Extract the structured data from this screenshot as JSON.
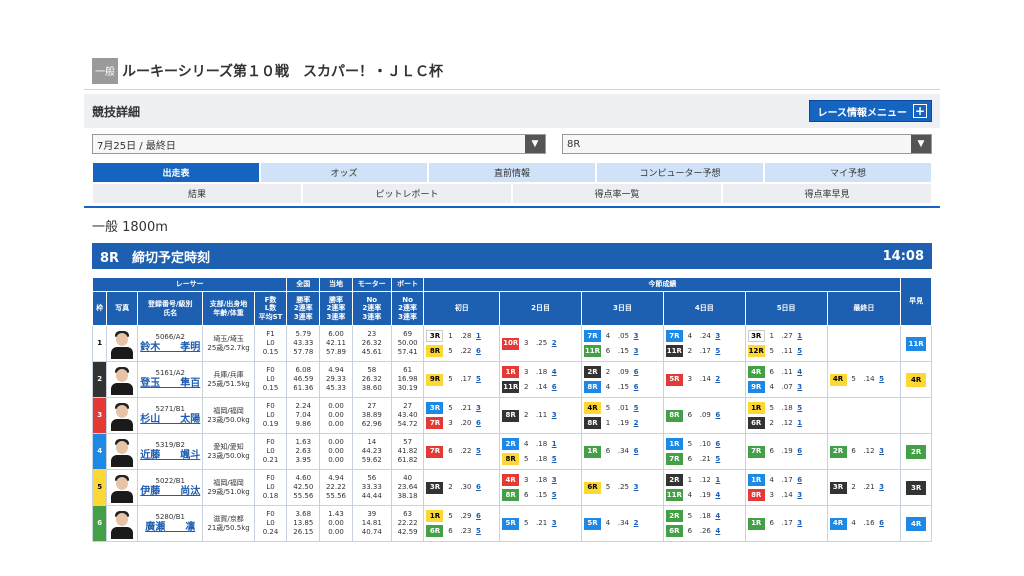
{
  "header": {
    "category_badge": "一般",
    "title": "ルーキーシリーズ第１０戦　スカパー！・ＪＬＣ杯"
  },
  "detail": {
    "heading": "競技詳細",
    "menu_button": "レース情報メニュー"
  },
  "selects": {
    "day": "7月25日 / 最終日",
    "race": "8R"
  },
  "tabs_row1": [
    "出走表",
    "オッズ",
    "直前情報",
    "コンピューター予想",
    "マイ予想"
  ],
  "tabs_row2": [
    "結果",
    "ピットレポート",
    "得点率一覧",
    "得点率早見"
  ],
  "race": {
    "name": "一般 1800m",
    "label": "8R　締切予定時刻",
    "time": "14:08"
  },
  "table_headers": {
    "racer": "レーサー",
    "zenkoku": "全国",
    "touchi": "当地",
    "motor": "モーター",
    "boat": "ボート",
    "konsetsu": "今節成績",
    "waku": "枠",
    "photo": "写真",
    "reg": "登録番号/級別\n氏名",
    "branch": "支部/出身地\n年齢/体重",
    "fls": "F数\nL数\n平均ST",
    "rate1": "勝率\n2連率\n3連率",
    "rate2": "勝率\n2連率\n3連率",
    "rate3": "No\n2連率\n3連率",
    "rate4": "No\n2連率\n3連率",
    "days": [
      "初日",
      "2日目",
      "3日目",
      "4日目",
      "5日目",
      "最終日"
    ],
    "hayami": "早見"
  },
  "racers": [
    {
      "frame": "1",
      "code": "5066/A2",
      "name": "鈴木　　孝明",
      "branch": "埼玉/埼玉",
      "age": "25歳/52.7kg",
      "f": "F1",
      "l": "L0",
      "st": "0.15",
      "z": [
        "5.79",
        "43.33",
        "57.78"
      ],
      "t": [
        "6.00",
        "42.11",
        "57.89"
      ],
      "m": [
        "23",
        "26.32",
        "45.61"
      ],
      "b": [
        "69",
        "50.00",
        "57.41"
      ],
      "d1": [
        [
          "3R",
          "1",
          ".28",
          "1",
          "c1"
        ],
        [
          "8R",
          "5",
          ".22",
          "6",
          "c5"
        ]
      ],
      "d2": [
        [
          "10R",
          "3",
          ".25",
          "2",
          "c3"
        ]
      ],
      "d3": [
        [
          "7R",
          "4",
          ".05",
          "3",
          "c4"
        ],
        [
          "11R",
          "6",
          ".15",
          "3",
          "c6"
        ]
      ],
      "d4": [
        [
          "7R",
          "4",
          ".24",
          "3",
          "c4"
        ],
        [
          "11R",
          "2",
          ".17",
          "5",
          "c2"
        ]
      ],
      "d5": [
        [
          "3R",
          "1",
          ".27",
          "1",
          "c1"
        ],
        [
          "12R",
          "5",
          ".11",
          "5",
          "c5"
        ]
      ],
      "d6": [],
      "hayami": "11R",
      "hc": "c4"
    },
    {
      "frame": "2",
      "code": "5161/A2",
      "name": "登玉　　隼百",
      "branch": "兵庫/兵庫",
      "age": "25歳/51.5kg",
      "f": "F0",
      "l": "L0",
      "st": "0.15",
      "z": [
        "6.08",
        "46.59",
        "61.36"
      ],
      "t": [
        "4.94",
        "29.33",
        "45.33"
      ],
      "m": [
        "58",
        "26.32",
        "38.60"
      ],
      "b": [
        "61",
        "16.98",
        "30.19"
      ],
      "d1": [
        [
          "9R",
          "5",
          ".17",
          "5",
          "c5"
        ]
      ],
      "d2": [
        [
          "1R",
          "3",
          ".18",
          "4",
          "c3"
        ],
        [
          "11R",
          "2",
          ".14",
          "6",
          "c2"
        ]
      ],
      "d3": [
        [
          "2R",
          "2",
          ".09",
          "6",
          "c2"
        ],
        [
          "8R",
          "4",
          ".15",
          "6",
          "c4"
        ]
      ],
      "d4": [
        [
          "5R",
          "3",
          ".14",
          "2",
          "c3"
        ]
      ],
      "d5": [
        [
          "4R",
          "6",
          ".11",
          "4",
          "c6"
        ],
        [
          "9R",
          "4",
          ".07",
          "3",
          "c4"
        ]
      ],
      "d6": [
        [
          "4R",
          "5",
          ".14",
          "5",
          "c5"
        ]
      ],
      "hayami": "4R",
      "hc": "c5"
    },
    {
      "frame": "3",
      "code": "5271/B1",
      "name": "杉山　　太陽",
      "branch": "福岡/福岡",
      "age": "23歳/50.0kg",
      "f": "F0",
      "l": "L0",
      "st": "0.19",
      "z": [
        "2.24",
        "7.04",
        "9.86"
      ],
      "t": [
        "0.00",
        "0.00",
        "0.00"
      ],
      "m": [
        "27",
        "38.89",
        "62.96"
      ],
      "b": [
        "27",
        "43.40",
        "54.72"
      ],
      "d1": [
        [
          "3R",
          "5",
          ".21",
          "3",
          "c4"
        ],
        [
          "7R",
          "3",
          ".20",
          "6",
          "c3"
        ]
      ],
      "d2": [
        [
          "8R",
          "2",
          ".11",
          "3",
          "c2"
        ]
      ],
      "d3": [
        [
          "4R",
          "5",
          ".01",
          "5",
          "c5"
        ],
        [
          "8R",
          "1",
          ".19",
          "2",
          "c2"
        ]
      ],
      "d4": [
        [
          "8R",
          "6",
          ".09",
          "6",
          "c6"
        ]
      ],
      "d5": [
        [
          "1R",
          "5",
          ".18",
          "5",
          "c5"
        ],
        [
          "6R",
          "2",
          ".12",
          "1",
          "c2"
        ]
      ],
      "d6": [],
      "hayami": "",
      "hc": "c1"
    },
    {
      "frame": "4",
      "code": "5319/B2",
      "name": "近藤　　颯斗",
      "branch": "愛知/愛知",
      "age": "23歳/50.0kg",
      "f": "F0",
      "l": "L0",
      "st": "0.21",
      "z": [
        "1.63",
        "2.63",
        "3.95"
      ],
      "t": [
        "0.00",
        "0.00",
        "0.00"
      ],
      "m": [
        "14",
        "44.23",
        "59.62"
      ],
      "b": [
        "57",
        "41.82",
        "61.82"
      ],
      "d1": [
        [
          "7R",
          "6",
          ".22",
          "5",
          "c3"
        ]
      ],
      "d2": [
        [
          "2R",
          "4",
          ".18",
          "1",
          "c4"
        ],
        [
          "8R",
          "5",
          ".18",
          "5",
          "c5"
        ]
      ],
      "d3": [
        [
          "1R",
          "6",
          ".34",
          "6",
          "c6"
        ]
      ],
      "d4": [
        [
          "1R",
          "5",
          ".10",
          "6",
          "c4"
        ],
        [
          "7R",
          "6",
          ".21",
          "5",
          "c6"
        ]
      ],
      "d5": [
        [
          "7R",
          "6",
          ".19",
          "6",
          "c6"
        ]
      ],
      "d6": [
        [
          "2R",
          "6",
          ".12",
          "3",
          "c6"
        ]
      ],
      "hayami": "2R",
      "hc": "c6"
    },
    {
      "frame": "5",
      "code": "5022/B1",
      "name": "伊藤　　尚汰",
      "branch": "福岡/福岡",
      "age": "29歳/51.0kg",
      "f": "F0",
      "l": "L0",
      "st": "0.18",
      "z": [
        "4.60",
        "42.50",
        "55.56"
      ],
      "t": [
        "4.94",
        "22.22",
        "55.56"
      ],
      "m": [
        "56",
        "33.33",
        "44.44"
      ],
      "b": [
        "40",
        "23.64",
        "38.18"
      ],
      "d1": [
        [
          "3R",
          "2",
          ".30",
          "6",
          "c2"
        ]
      ],
      "d2": [
        [
          "4R",
          "3",
          ".18",
          "3",
          "c3"
        ],
        [
          "8R",
          "6",
          ".15",
          "5",
          "c6"
        ]
      ],
      "d3": [
        [
          "6R",
          "5",
          ".25",
          "3",
          "c5"
        ]
      ],
      "d4": [
        [
          "2R",
          "1",
          ".12",
          "1",
          "c2"
        ],
        [
          "11R",
          "4",
          ".19",
          "4",
          "c6"
        ]
      ],
      "d5": [
        [
          "1R",
          "4",
          ".17",
          "6",
          "c4"
        ],
        [
          "8R",
          "3",
          ".14",
          "3",
          "c3"
        ]
      ],
      "d6": [
        [
          "3R",
          "2",
          ".21",
          "3",
          "c2"
        ]
      ],
      "hayami": "3R",
      "hc": "c2"
    },
    {
      "frame": "6",
      "code": "5280/B1",
      "name": "廣瀬　　凛",
      "branch": "滋賀/京都",
      "age": "21歳/50.5kg",
      "f": "F0",
      "l": "L0",
      "st": "0.24",
      "z": [
        "3.68",
        "13.85",
        "26.15"
      ],
      "t": [
        "1.43",
        "0.00",
        "0.00"
      ],
      "m": [
        "39",
        "14.81",
        "40.74"
      ],
      "b": [
        "63",
        "22.22",
        "42.59"
      ],
      "d1": [
        [
          "1R",
          "5",
          ".29",
          "6",
          "c5"
        ],
        [
          "6R",
          "6",
          ".23",
          "5",
          "c6"
        ]
      ],
      "d2": [
        [
          "5R",
          "5",
          ".21",
          "3",
          "c4"
        ]
      ],
      "d3": [
        [
          "5R",
          "4",
          ".34",
          "2",
          "c4"
        ]
      ],
      "d4": [
        [
          "2R",
          "5",
          ".18",
          "4",
          "c6"
        ],
        [
          "6R",
          "6",
          ".26",
          "4",
          "c6"
        ]
      ],
      "d5": [
        [
          "1R",
          "6",
          ".17",
          "3",
          "c6"
        ]
      ],
      "d6": [
        [
          "4R",
          "4",
          ".16",
          "6",
          "c4"
        ]
      ],
      "hayami": "4R",
      "hc": "c4"
    }
  ]
}
